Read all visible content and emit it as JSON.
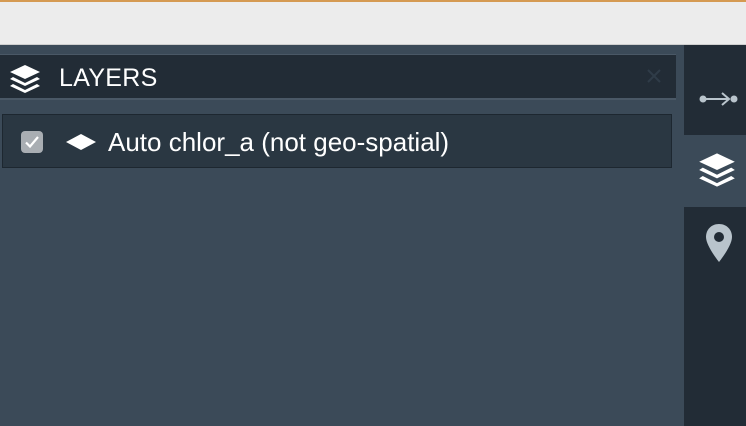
{
  "panel": {
    "title": "LAYERS",
    "header_icon": "layers-icon",
    "close_icon": "close-icon"
  },
  "layers": [
    {
      "label": "Auto chlor_a (not geo-spatial)",
      "checked": true,
      "type_icon": "layer-diamond-icon"
    }
  ],
  "sidebar_tabs": [
    {
      "icon": "connect-arrow-icon",
      "active": false
    },
    {
      "icon": "layers-icon",
      "active": true
    },
    {
      "icon": "map-marker-icon",
      "active": false
    }
  ],
  "colors": {
    "panel_bg": "#3b4a58",
    "header_bg": "#222c36",
    "row_bg": "#2a3742",
    "sidebar_bg": "#222c36",
    "window_accent": "#d59a52"
  }
}
